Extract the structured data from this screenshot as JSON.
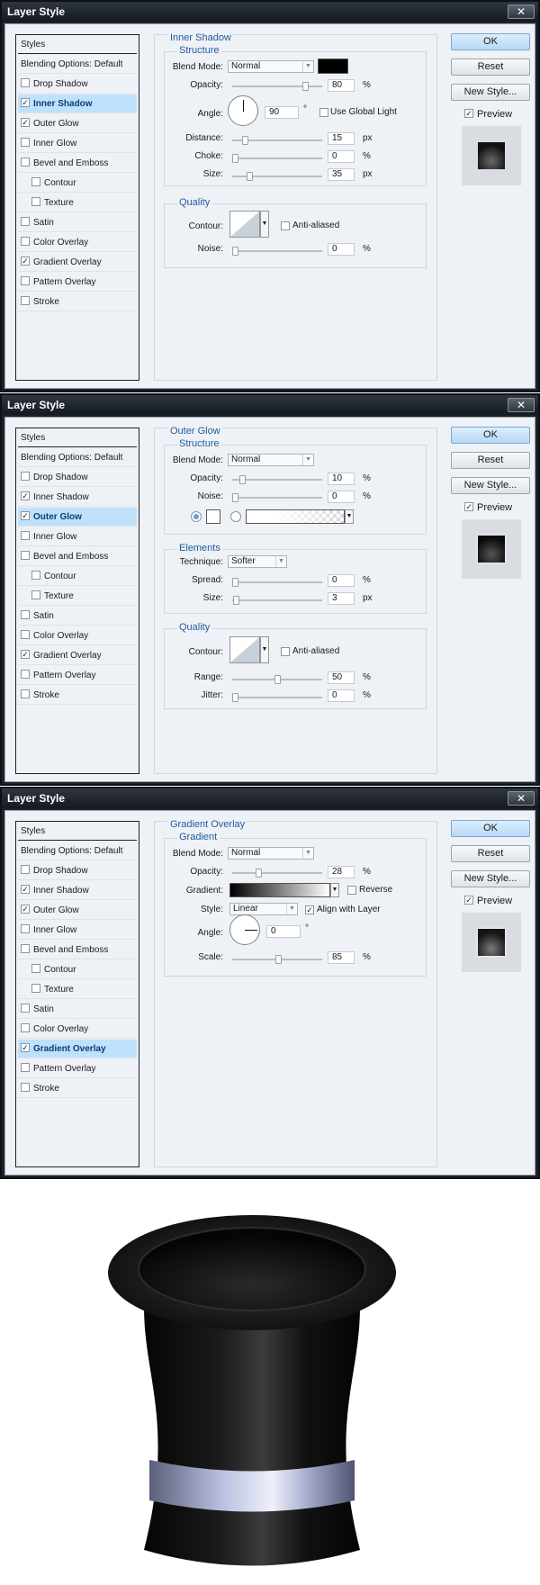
{
  "dialog_title": "Layer Style",
  "close_symbol": "✕",
  "styles_list": [
    "Styles",
    "Blending Options: Default",
    "Drop Shadow",
    "Inner Shadow",
    "Outer Glow",
    "Inner Glow",
    "Bevel and Emboss",
    "Contour",
    "Texture",
    "Satin",
    "Color Overlay",
    "Gradient Overlay",
    "Pattern Overlay",
    "Stroke"
  ],
  "buttons": {
    "ok": "OK",
    "reset": "Reset",
    "new_style": "New Style...",
    "preview": "Preview"
  },
  "check_glyph": "✓",
  "arrow_glyph": "▼",
  "dialog1": {
    "panel_title": "Inner Shadow",
    "structure_title": "Structure",
    "blend_mode_label": "Blend Mode:",
    "blend_mode": "Normal",
    "opacity_label": "Opacity:",
    "opacity": "80",
    "angle_label": "Angle:",
    "angle": "90",
    "degree": "°",
    "global_light": "Use Global Light",
    "distance_label": "Distance:",
    "distance": "15",
    "choke_label": "Choke:",
    "choke": "0",
    "size_label": "Size:",
    "size": "35",
    "quality_title": "Quality",
    "contour_label": "Contour:",
    "anti_aliased": "Anti-aliased",
    "noise_label": "Noise:",
    "noise": "0",
    "pct": "%",
    "px": "px"
  },
  "dialog2": {
    "panel_title": "Outer Glow",
    "structure_title": "Structure",
    "blend_mode_label": "Blend Mode:",
    "blend_mode": "Normal",
    "opacity_label": "Opacity:",
    "opacity": "10",
    "noise_label": "Noise:",
    "noise": "0",
    "elements_title": "Elements",
    "technique_label": "Technique:",
    "technique": "Softer",
    "spread_label": "Spread:",
    "spread": "0",
    "size_label": "Size:",
    "size": "3",
    "quality_title": "Quality",
    "contour_label": "Contour:",
    "anti_aliased": "Anti-aliased",
    "range_label": "Range:",
    "range": "50",
    "jitter_label": "Jitter:",
    "jitter": "0",
    "pct": "%",
    "px": "px"
  },
  "dialog3": {
    "panel_title": "Gradient Overlay",
    "gradient_title": "Gradient",
    "blend_mode_label": "Blend Mode:",
    "blend_mode": "Normal",
    "opacity_label": "Opacity:",
    "opacity": "28",
    "gradient_label": "Gradient:",
    "reverse": "Reverse",
    "style_label": "Style:",
    "style": "Linear",
    "align": "Align with Layer",
    "angle_label": "Angle:",
    "angle": "0",
    "degree": "°",
    "scale_label": "Scale:",
    "scale": "85",
    "pct": "%"
  }
}
